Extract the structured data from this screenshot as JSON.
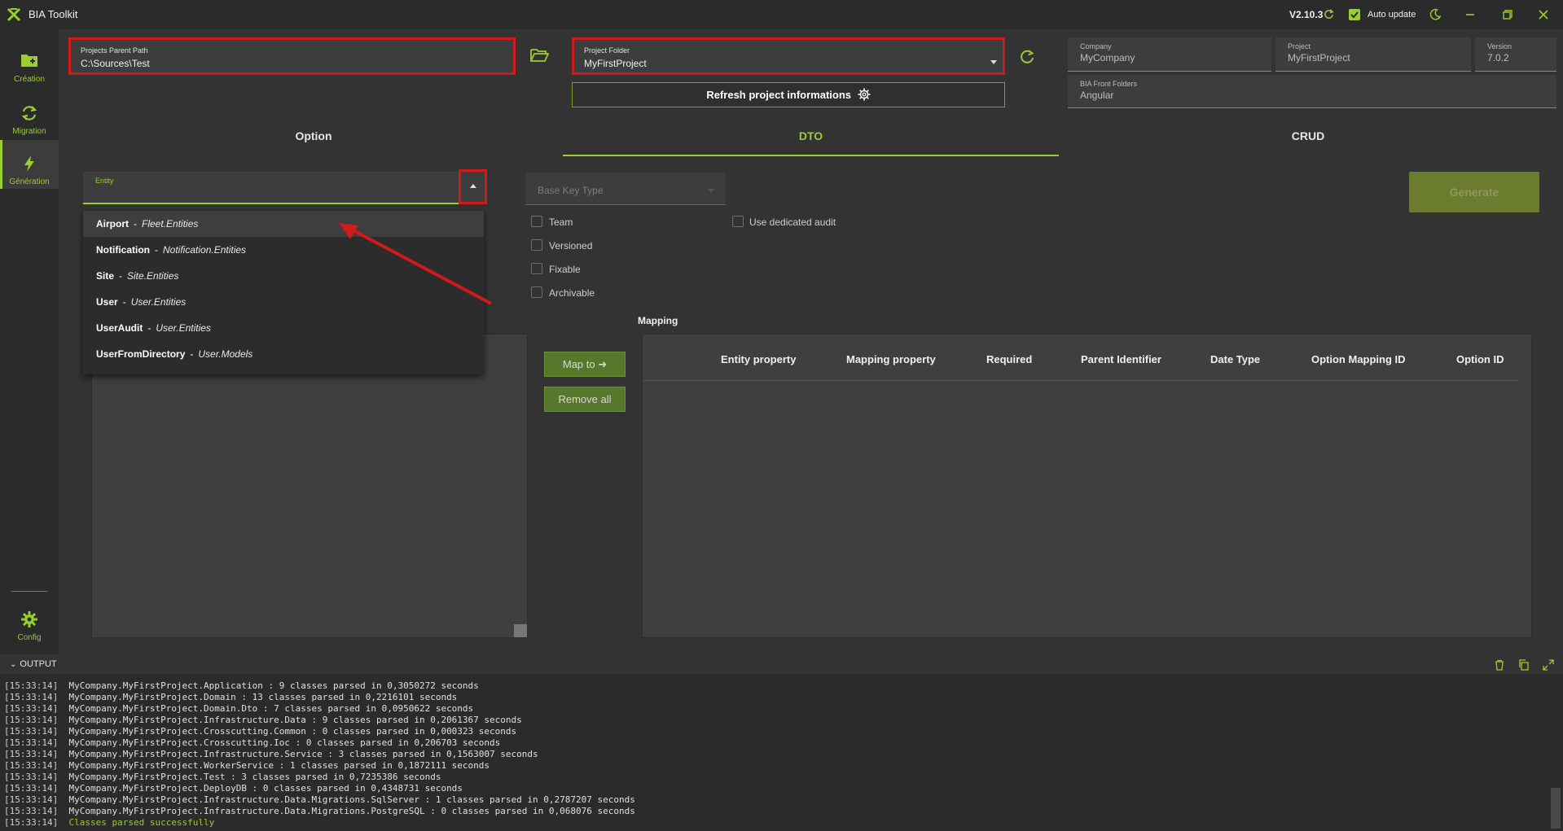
{
  "window": {
    "title": "BIA Toolkit",
    "version": "V2.10.3",
    "auto_update_label": "Auto update"
  },
  "sidebar": {
    "items": [
      {
        "label": "Création"
      },
      {
        "label": "Migration"
      },
      {
        "label": "Génération"
      },
      {
        "label": "Config"
      }
    ]
  },
  "top": {
    "parent_path_label": "Projects Parent Path",
    "parent_path_value": "C:\\Sources\\Test",
    "project_folder_label": "Project Folder",
    "project_folder_value": "MyFirstProject",
    "refresh_button_label": "Refresh project informations",
    "company_label": "Company",
    "company_value": "MyCompany",
    "project_label": "Project",
    "project_value": "MyFirstProject",
    "version_label": "Version",
    "version_value": "7.0.2",
    "front_folders_label": "BIA Front Folders",
    "front_folders_value": "Angular"
  },
  "tabs": [
    {
      "label": "Option"
    },
    {
      "label": "DTO",
      "active": true
    },
    {
      "label": "CRUD"
    }
  ],
  "dto": {
    "entity_label": "Entity",
    "entity_options": [
      {
        "name": "Airport",
        "namespace": "Fleet.Entities"
      },
      {
        "name": "Notification",
        "namespace": "Notification.Entities"
      },
      {
        "name": "Site",
        "namespace": "Site.Entities"
      },
      {
        "name": "User",
        "namespace": "User.Entities"
      },
      {
        "name": "UserAudit",
        "namespace": "User.Entities"
      },
      {
        "name": "UserFromDirectory",
        "namespace": "User.Models"
      }
    ],
    "option_separator": "-",
    "base_key_placeholder": "Base Key Type",
    "checkboxes": {
      "team": "Team",
      "versioned": "Versioned",
      "fixable": "Fixable",
      "archivable": "Archivable",
      "dedicated_audit": "Use dedicated audit"
    },
    "generate_label": "Generate",
    "mapping_title": "Mapping",
    "map_to_label": "Map to ➜",
    "remove_all_label": "Remove all",
    "mapping_columns": [
      "Entity property",
      "Mapping property",
      "Required",
      "Parent Identifier",
      "Date Type",
      "Option Mapping ID",
      "Option ID"
    ]
  },
  "output": {
    "title": "OUTPUT",
    "lines": [
      {
        "ts": "[15:33:14]",
        "msg": "MyCompany.MyFirstProject.Application : 9 classes parsed in 0,3050272 seconds"
      },
      {
        "ts": "[15:33:14]",
        "msg": "MyCompany.MyFirstProject.Domain : 13 classes parsed in 0,2216101 seconds"
      },
      {
        "ts": "[15:33:14]",
        "msg": "MyCompany.MyFirstProject.Domain.Dto : 7 classes parsed in 0,0950622 seconds"
      },
      {
        "ts": "[15:33:14]",
        "msg": "MyCompany.MyFirstProject.Infrastructure.Data : 9 classes parsed in 0,2061367 seconds"
      },
      {
        "ts": "[15:33:14]",
        "msg": "MyCompany.MyFirstProject.Crosscutting.Common : 0 classes parsed in 0,000323 seconds"
      },
      {
        "ts": "[15:33:14]",
        "msg": "MyCompany.MyFirstProject.Crosscutting.Ioc : 0 classes parsed in 0,206703 seconds"
      },
      {
        "ts": "[15:33:14]",
        "msg": "MyCompany.MyFirstProject.Infrastructure.Service : 3 classes parsed in 0,1563007 seconds"
      },
      {
        "ts": "[15:33:14]",
        "msg": "MyCompany.MyFirstProject.WorkerService : 1 classes parsed in 0,1872111 seconds"
      },
      {
        "ts": "[15:33:14]",
        "msg": "MyCompany.MyFirstProject.Test : 3 classes parsed in 0,7235386 seconds"
      },
      {
        "ts": "[15:33:14]",
        "msg": "MyCompany.MyFirstProject.DeployDB : 0 classes parsed in 0,4348731 seconds"
      },
      {
        "ts": "[15:33:14]",
        "msg": "MyCompany.MyFirstProject.Infrastructure.Data.Migrations.SqlServer : 1 classes parsed in 0,2787207 seconds"
      },
      {
        "ts": "[15:33:14]",
        "msg": "MyCompany.MyFirstProject.Infrastructure.Data.Migrations.PostgreSQL : 0 classes parsed in 0,068076 seconds"
      },
      {
        "ts": "[15:33:14]",
        "msg": "Classes parsed successfully"
      }
    ]
  },
  "colors": {
    "accent": "#9acd32",
    "highlight_box": "#d11a1a",
    "background": "#333333",
    "panel": "#3f3f3f"
  }
}
